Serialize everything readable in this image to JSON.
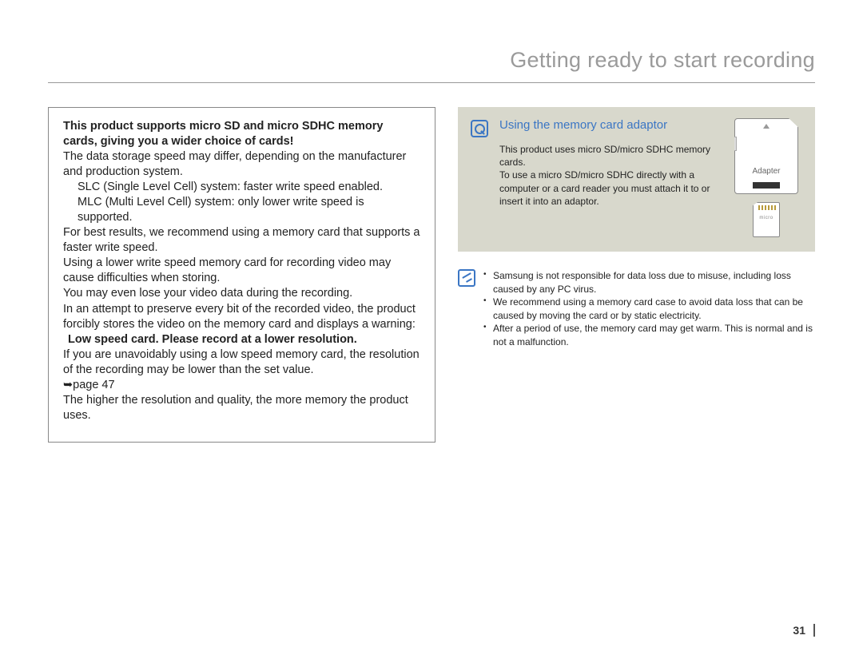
{
  "page_title": "Getting ready to start recording",
  "page_number": "31",
  "left": {
    "intro_bold": "This product supports micro SD and micro SDHC memory cards, giving you a wider choice of cards!",
    "p1": "The data storage speed may differ, depending on the manufacturer and production system.",
    "bullet_slc": "SLC (Single Level Cell) system: faster write speed enabled.",
    "bullet_mlc": "MLC (Multi Level Cell) system: only lower write speed is supported.",
    "p2": "For best results, we recommend using a memory card that supports a faster write speed.",
    "p3": "Using a lower write speed memory card for recording video may cause difficulties when storing.",
    "p4": "You may even lose your video data during the recording.",
    "p5": "In an attempt to preserve every bit of the recorded video, the product forcibly stores the video on the memory card and displays a warning:",
    "warning": "Low speed card. Please record at a lower resolution.",
    "p6": "If you are unavoidably using a low speed memory card, the resolution of the recording may be lower than the set value.",
    "page_ref": "➥page 47",
    "p7": "The higher the resolution and quality, the more memory the product uses."
  },
  "tip": {
    "title": "Using the memory card adaptor",
    "line1": "This product uses micro SD/micro SDHC memory cards.",
    "line2": "To use a micro SD/micro SDHC directly with a computer or a card reader you must attach it to or insert it into an adaptor.",
    "adapter_label": "Adapter"
  },
  "notes": {
    "n1": "Samsung is not responsible for data loss due to misuse, including loss caused by any PC virus.",
    "n2": "We recommend using a memory card case to avoid data loss that can be caused by moving the card or by static electricity.",
    "n3": "After a period of use, the memory card may get warm. This is normal and is not a malfunction."
  }
}
